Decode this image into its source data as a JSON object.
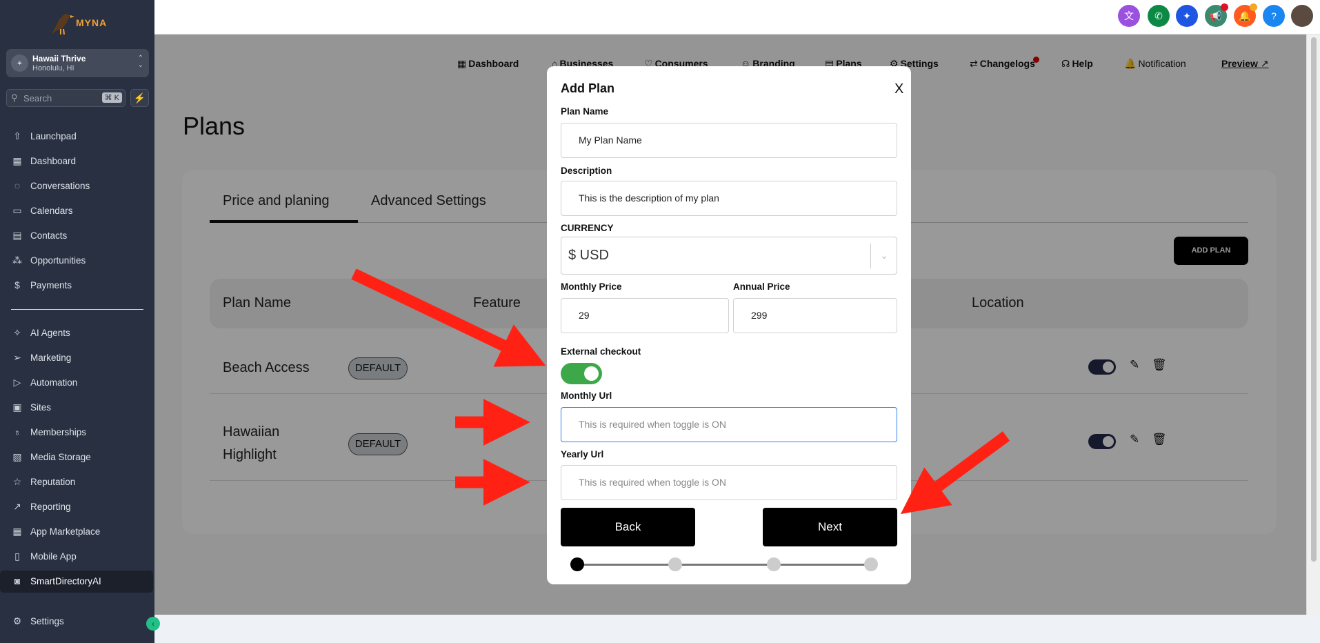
{
  "sidebar": {
    "logo_text": "MYNA",
    "location": {
      "name": "Hawaii Thrive",
      "city": "Honolulu, HI"
    },
    "search": {
      "placeholder": "Search",
      "shortcut": "⌘ K"
    },
    "items_top": [
      {
        "label": "Launchpad",
        "icon": "launchpad-icon",
        "glyph": "⇧"
      },
      {
        "label": "Dashboard",
        "icon": "dashboard-icon",
        "glyph": "▦"
      },
      {
        "label": "Conversations",
        "icon": "chat-bubble-icon",
        "glyph": "◌"
      },
      {
        "label": "Calendars",
        "icon": "calendar-icon",
        "glyph": "▭"
      },
      {
        "label": "Contacts",
        "icon": "contacts-icon",
        "glyph": "▤"
      },
      {
        "label": "Opportunities",
        "icon": "opportunities-icon",
        "glyph": "⁂"
      },
      {
        "label": "Payments",
        "icon": "payments-icon",
        "glyph": "$"
      }
    ],
    "items_bottom": [
      {
        "label": "AI Agents",
        "icon": "sparkle-icon",
        "glyph": "✧"
      },
      {
        "label": "Marketing",
        "icon": "send-icon",
        "glyph": "➢"
      },
      {
        "label": "Automation",
        "icon": "play-circle-icon",
        "glyph": "▷"
      },
      {
        "label": "Sites",
        "icon": "sites-icon",
        "glyph": "▣"
      },
      {
        "label": "Memberships",
        "icon": "award-icon",
        "glyph": "♁"
      },
      {
        "label": "Media Storage",
        "icon": "image-icon",
        "glyph": "▨"
      },
      {
        "label": "Reputation",
        "icon": "star-icon",
        "glyph": "☆"
      },
      {
        "label": "Reporting",
        "icon": "trend-icon",
        "glyph": "↗"
      },
      {
        "label": "App Marketplace",
        "icon": "apps-grid-icon",
        "glyph": "▦"
      },
      {
        "label": "Mobile App",
        "icon": "mobile-icon",
        "glyph": "▯"
      },
      {
        "label": "SmartDirectoryAI",
        "icon": "directory-book-icon",
        "glyph": "◙"
      }
    ],
    "settings": "Settings"
  },
  "topbar": {
    "icons": [
      {
        "name": "translate-icon",
        "glyph": "文",
        "color": "#9b51e0"
      },
      {
        "name": "phone-icon",
        "glyph": "✆",
        "color": "#0c8a45"
      },
      {
        "name": "ai-sparkle-icon",
        "glyph": "✦",
        "color": "#1e55e3"
      },
      {
        "name": "megaphone-icon",
        "glyph": "📢",
        "color": "#3a8a70"
      },
      {
        "name": "bell-icon",
        "glyph": "🔔",
        "color": "#ff5a1f"
      },
      {
        "name": "help-icon",
        "glyph": "?",
        "color": "#1a86f0"
      },
      {
        "name": "user-avatar",
        "glyph": "",
        "color": "#5a4a40"
      }
    ]
  },
  "nav": {
    "dashboard": "Dashboard",
    "businesses": "Businesses",
    "consumers": "Consumers",
    "branding": "Branding",
    "plans": "Plans",
    "settings": "Settings",
    "changelogs": "Changelogs",
    "help": "Help",
    "notification": "Notification",
    "preview": "Preview"
  },
  "page": {
    "title": "Plans",
    "tabs": [
      "Price and planing",
      "Advanced Settings"
    ],
    "add_plan": "ADD PLAN",
    "columns": [
      "Plan Name",
      "Feature",
      "Location"
    ],
    "rows": [
      {
        "name": "Beach Access",
        "badge": "DEFAULT",
        "active": true
      },
      {
        "name_line1": "Hawaiian",
        "name_line2": "Highlight",
        "badge": "DEFAULT",
        "active": true
      }
    ]
  },
  "modal": {
    "title": "Add Plan",
    "close": "X",
    "plan_name_label": "Plan Name",
    "plan_name_value": "My Plan Name",
    "description_label": "Description",
    "description_value": "This is the description of my plan",
    "currency_label": "CURRENCY",
    "currency_value": "$ USD",
    "monthly_price_label": "Monthly Price",
    "monthly_price_value": "29",
    "annual_price_label": "Annual Price",
    "annual_price_value": "299",
    "external_checkout_label": "External checkout",
    "external_checkout_on": true,
    "monthly_url_label": "Monthly Url",
    "monthly_url_placeholder": "This is required when toggle is ON",
    "yearly_url_label": "Yearly Url",
    "yearly_url_placeholder": "This is required when toggle is ON",
    "back": "Back",
    "next": "Next",
    "step_current": 1,
    "step_total": 4
  },
  "colors": {
    "accent_toggle": "#3da84a",
    "annotation_arrow": "#ff2214",
    "sidebar_bg": "#283041"
  }
}
